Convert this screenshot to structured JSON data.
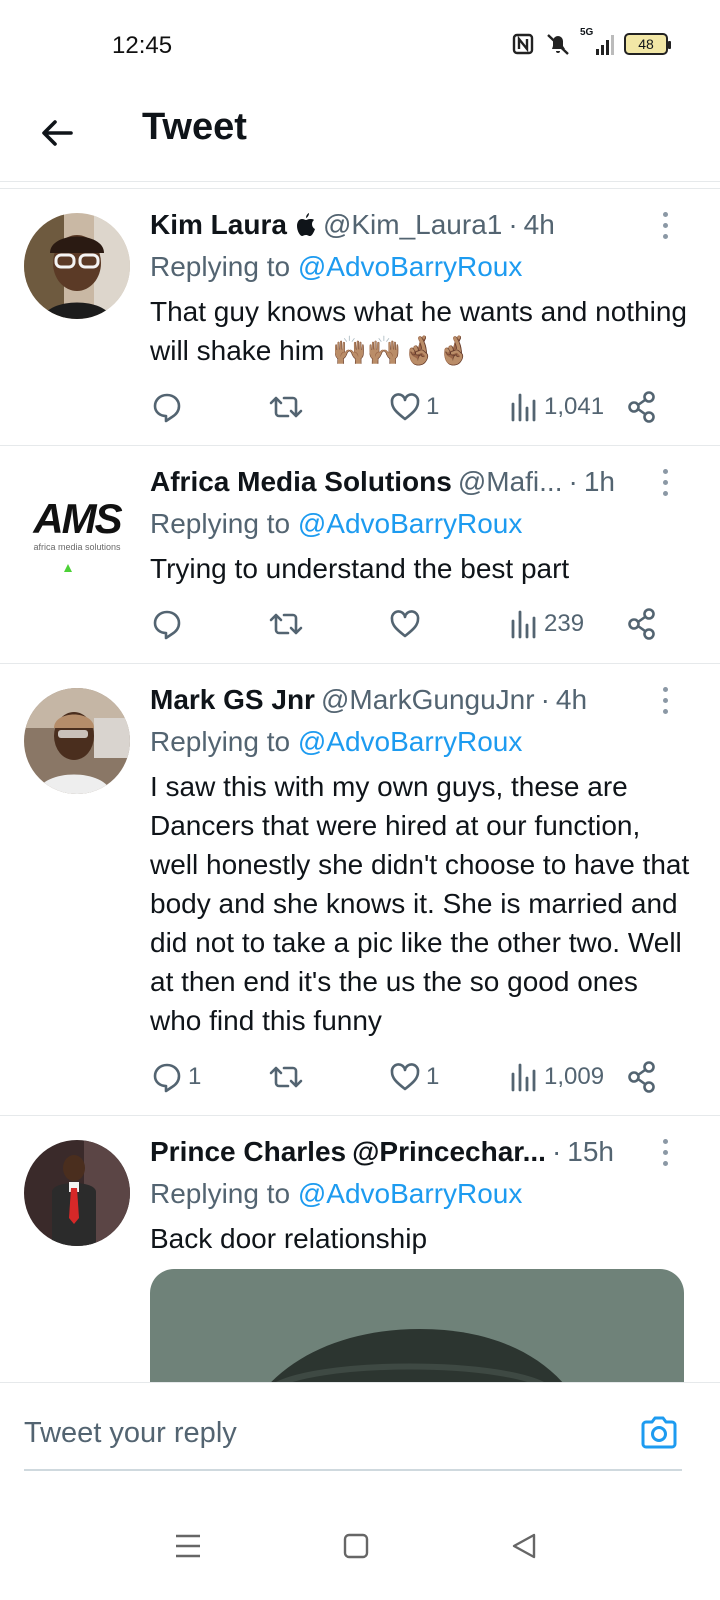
{
  "status_bar": {
    "time": "12:45",
    "battery": "48",
    "network": "5G"
  },
  "header": {
    "title": "Tweet"
  },
  "tweets": [
    {
      "name": "Kim Laura",
      "handle": "@Kim_Laura1",
      "separator": "·",
      "time": "4h",
      "reply_prefix": "Replying to",
      "reply_mention": "@AdvoBarryRoux",
      "text": "That guy knows what he wants and nothing will shake him 🙌🏽🙌🏽🤞🏽🤞🏽",
      "replies": "",
      "retweets": "",
      "likes": "1",
      "views": "1,041"
    },
    {
      "name": "Africa Media Solutions",
      "handle": "@Mafi...",
      "separator": "·",
      "time": "1h",
      "reply_prefix": "Replying to",
      "reply_mention": "@AdvoBarryRoux",
      "text": "Trying to understand the best part",
      "avatar_logo": "AMS",
      "avatar_tagline": "africa media solutions",
      "replies": "",
      "retweets": "",
      "likes": "",
      "views": "239"
    },
    {
      "name": "Mark GS Jnr",
      "handle": "@MarkGunguJnr",
      "separator": "·",
      "time": "4h",
      "reply_prefix": "Replying to",
      "reply_mention": "@AdvoBarryRoux",
      "text": "I saw this with my own guys, these are Dancers that were hired at our function, well honestly she didn't choose to have that body and she knows it. She is married and did not to take a pic like the other two. Well at then end it's the us the so good ones who find this funny",
      "replies": "1",
      "retweets": "",
      "likes": "1",
      "views": "1,009"
    },
    {
      "name": "Prince Charles",
      "handle": "@Princechar...",
      "separator": "·",
      "time": "15h",
      "reply_prefix": "Replying to",
      "reply_mention": "@AdvoBarryRoux",
      "text": "Back door relationship"
    }
  ],
  "reply_bar": {
    "placeholder": "Tweet your reply"
  },
  "colors": {
    "accent": "#1d9bf0",
    "text": "#0f1419",
    "secondary": "#536471",
    "divider": "#e6e9eb"
  }
}
